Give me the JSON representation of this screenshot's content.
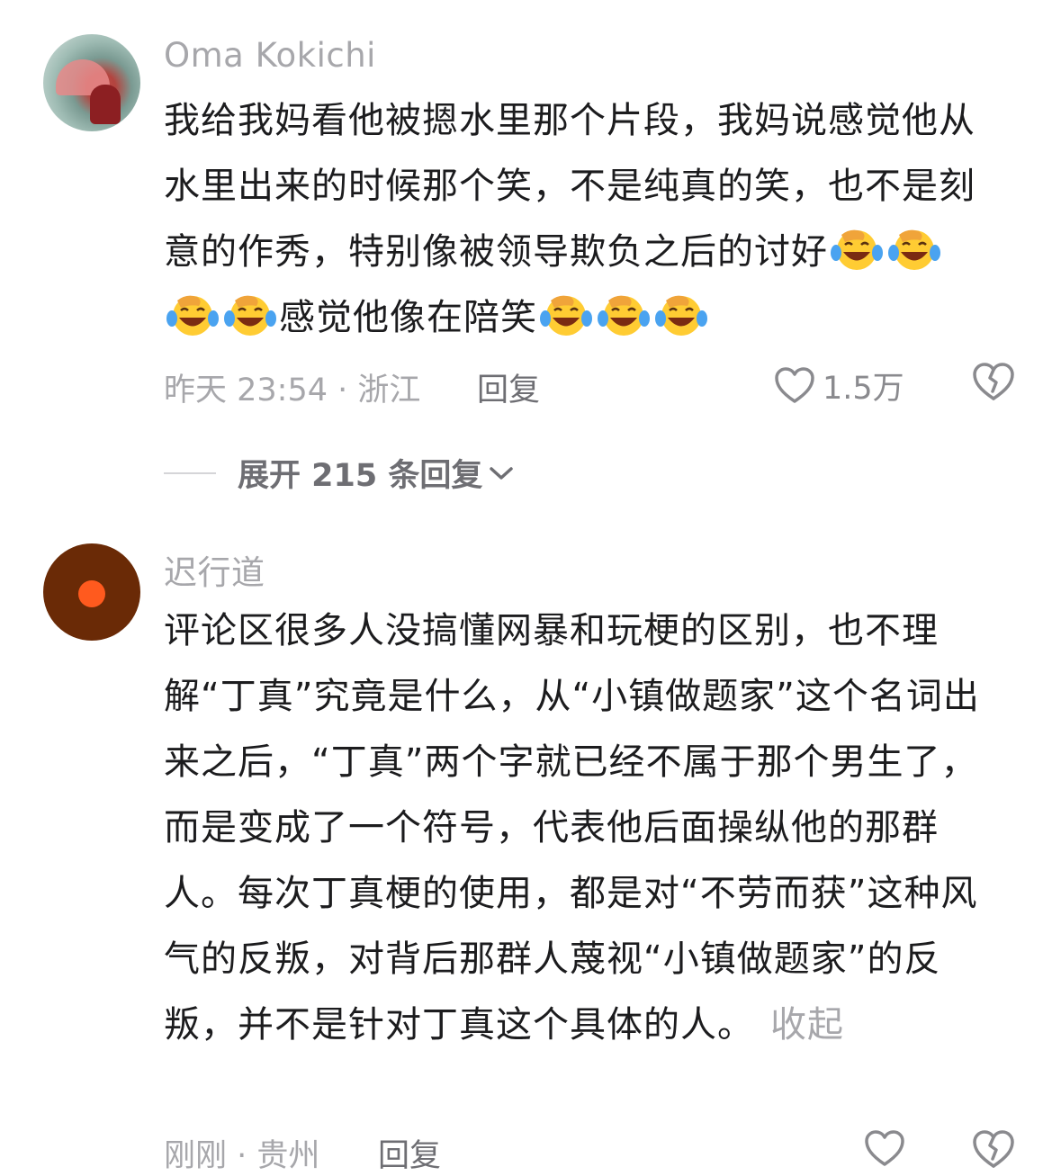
{
  "comments": [
    {
      "username": "Oma Kokichi",
      "text_segments": [
        "我给我妈看他被摁水里那个片段，我妈说感觉他从水里出来的时候那个笑，不是纯真的笑，也不是刻意的作秀，特别像被领导欺负之后的讨好",
        "感觉他像在陪笑"
      ],
      "emoji_name": "tears-of-joy-emoji",
      "emoji_count_first": 4,
      "emoji_count_second": 3,
      "time_location": "昨天 23:54 · 浙江",
      "reply_label": "回复",
      "like_count": "1.5万",
      "expand_label": "展开 215 条回复"
    },
    {
      "username": "迟行道",
      "text": "评论区很多人没搞懂网暴和玩梗的区别，也不理解“丁真”究竟是什么，从“小镇做题家”这个名词出来之后，“丁真”两个字就已经不属于那个男生了，而是变成了一个符号，代表他后面操纵他的那群人。每次丁真梗的使用，都是对“不劳而获”这种风气的反叛，对背后那群人蔑视“小镇做题家”的反叛，并不是针对丁真这个具体的人。",
      "collapse_label": "收起",
      "time_location": "刚刚 · 贵州",
      "reply_label": "回复"
    }
  ],
  "icons": {
    "like": "heart-outline-icon",
    "dislike": "broken-heart-icon",
    "expand": "chevron-down-icon"
  },
  "colors": {
    "text": "#1c1c1e",
    "secondary": "#a7a7ab",
    "reply": "#6e6e73",
    "emoji_face": "#ffcc33",
    "emoji_tear": "#4aa3f0"
  }
}
